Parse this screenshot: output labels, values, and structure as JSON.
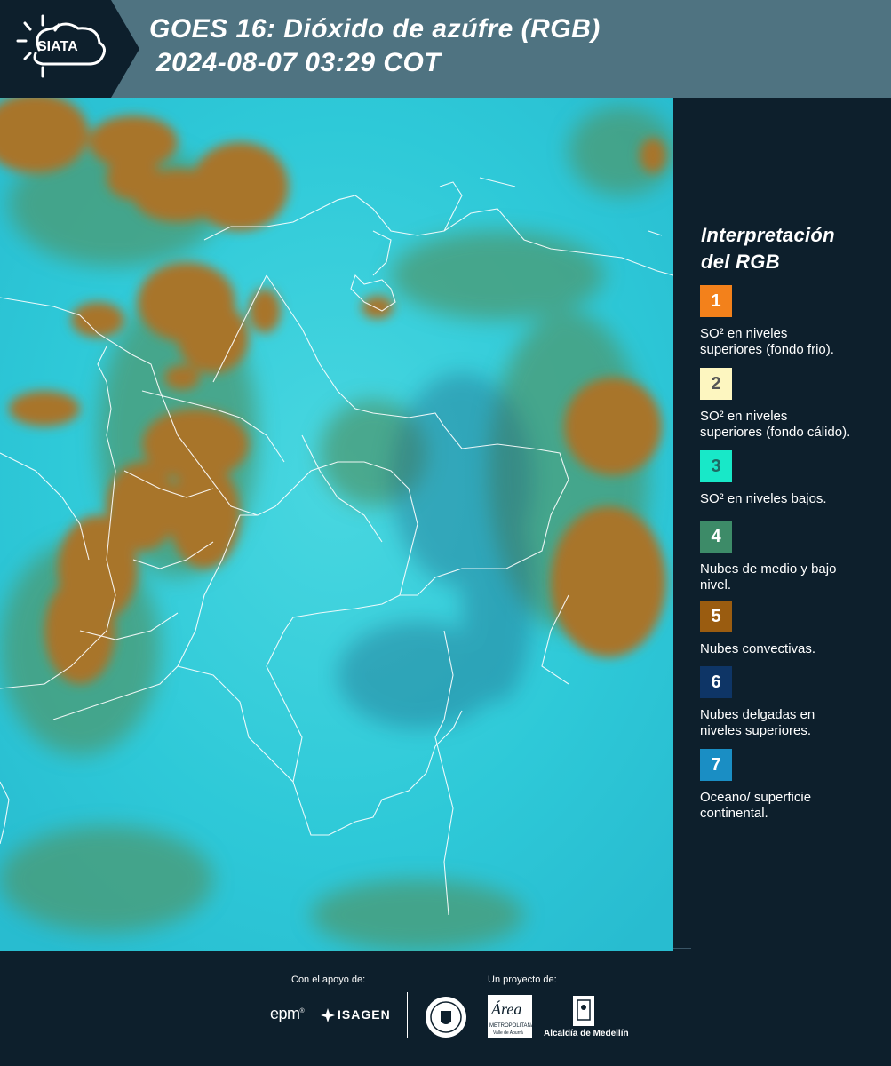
{
  "header": {
    "logo_text": "SIATA",
    "title_line1": "GOES 16: Dióxido de azúfre (RGB)",
    "title_line2": "2024-08-07 03:29 COT",
    "bg_color": "#4f7381"
  },
  "legend": {
    "title_line1": "Interpretación",
    "title_line2": "del RGB",
    "items": [
      {
        "number": "1",
        "color": "#f3811b",
        "text_line1": "SO² en niveles",
        "text_line2": "superiores (fondo frio).",
        "number_color": "#ffffff"
      },
      {
        "number": "2",
        "color": "#fdf6c0",
        "text_line1": "SO² en niveles",
        "text_line2": "superiores (fondo cálido).",
        "number_color": "#555555"
      },
      {
        "number": "3",
        "color": "#18e8c8",
        "text_line1": "SO² en niveles bajos.",
        "text_line2": "",
        "number_color": "#1e6b64"
      },
      {
        "number": "4",
        "color": "#3d8b68",
        "text_line1": "Nubes de medio y bajo",
        "text_line2": "nivel.",
        "number_color": "#ffffff"
      },
      {
        "number": "5",
        "color": "#9a5c10",
        "text_line1": "Nubes convectivas.",
        "text_line2": "",
        "number_color": "#ffffff"
      },
      {
        "number": "6",
        "color": "#0e3566",
        "text_line1": "Nubes delgadas en",
        "text_line2": "niveles superiores.",
        "number_color": "#ffffff"
      },
      {
        "number": "7",
        "color": "#1a8ec4",
        "text_line1": "Oceano/ superficie",
        "text_line2": "continental.",
        "number_color": "#ffffff"
      }
    ]
  },
  "footer": {
    "support_label": "Con el apoyo de:",
    "project_label": "Un proyecto de:",
    "epm": "epm",
    "isagen": "ISAGEN",
    "area_name": "Área",
    "area_sub1": "METROPOLITANA",
    "area_sub2": "Valle de Aburrá",
    "alcaldia": "Alcaldía de Medellín"
  },
  "map": {
    "background_color": "#2cc8d6",
    "cloud_color": "#a8752a",
    "mid_cloud_color": "#4c9a73"
  }
}
